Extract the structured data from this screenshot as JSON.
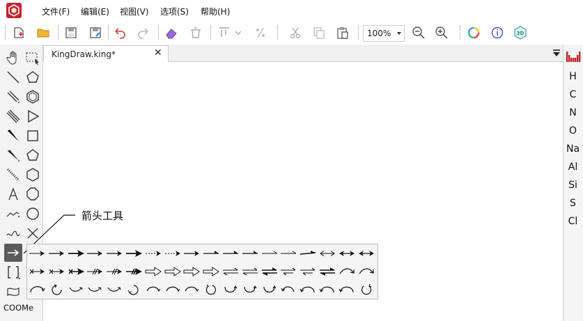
{
  "app": {
    "logo_icon": "kingdraw-logo-icon",
    "brand_color": "#c8202a"
  },
  "menu": [
    {
      "label": "文件(F)"
    },
    {
      "label": "编辑(E)"
    },
    {
      "label": "视图(V)"
    },
    {
      "label": "选项(S)"
    },
    {
      "label": "帮助(H)"
    }
  ],
  "toolbar": {
    "zoom_value": "100%",
    "view_3d_label": "3D",
    "buttons": [
      "new-file-icon",
      "open-folder-icon",
      "save-icon",
      "save-as-icon",
      "undo-icon",
      "redo-icon",
      "eraser-icon",
      "trash-icon",
      "align-icon",
      "fraction-icon",
      "cut-icon",
      "copy-icon",
      "paste-icon",
      "zoom-out-icon",
      "zoom-in-icon",
      "color-ring-icon",
      "info-icon",
      "3d-view-icon"
    ]
  },
  "tab": {
    "title": "KingDraw.king*",
    "close_label": "✕"
  },
  "left_tools": {
    "callout": "箭头工具",
    "bottom_label": "COOMe",
    "tools": [
      "hand-icon",
      "select-box-icon",
      "line-icon",
      "pentagon-icon",
      "double-line-icon",
      "hexagon-icon",
      "triple-line-icon",
      "triangle-icon",
      "wedge-bond-icon",
      "square-icon",
      "hash-bond-icon",
      "pentagon-outline-icon",
      "dashed-bond-icon",
      "hexagon-outline-icon",
      "text-icon",
      "octagon-icon",
      "chain-icon",
      "circle-icon",
      "wavy-icon",
      "cross-icon",
      "arrow-icon",
      "bracket-icon",
      "flag-icon"
    ]
  },
  "elements": [
    "H",
    "C",
    "N",
    "O",
    "Na",
    "Al",
    "Si",
    "S",
    "Cl"
  ],
  "flyout": {
    "rows": [
      [
        "arrow-thin",
        "arrow-medium",
        "arrow-bold",
        "arrow-medium",
        "arrow-medium",
        "arrow-bold",
        "arrow-dotted",
        "arrow-dotted",
        "arrow-medium",
        "arrow-half-up",
        "arrow-half-up",
        "arrow-half-up",
        "arrow-half-thin",
        "arrow-half-thin",
        "arrow-half-bold",
        "arrow-double-end",
        "arrow-double-head",
        "arrow-double-head"
      ],
      [
        "arrow-x-tail",
        "arrow-x-tail",
        "arrow-x-tail-bold",
        "arrow-strike",
        "arrow-strike",
        "arrow-strike-bold",
        "arrow-hollow",
        "arrow-hollow",
        "arrow-hollow",
        "arrow-hollow",
        "equilibrium",
        "equilibrium",
        "equilibrium-bold",
        "equilibrium-short",
        "equilibrium-short",
        "equilibrium-bold",
        "curve-arrow",
        "curve-arrow"
      ],
      [
        "curve-arc",
        "curve-ccw",
        "curve-down",
        "curve-down",
        "curve-down",
        "curve-cw",
        "curve-hook",
        "curve-hook",
        "curve-hook",
        "curve-circle",
        "curve-u",
        "curve-u",
        "curve-u",
        "curve-loop",
        "curve-back",
        "curve-back",
        "curve-back",
        "curve-circle-cw"
      ]
    ]
  }
}
